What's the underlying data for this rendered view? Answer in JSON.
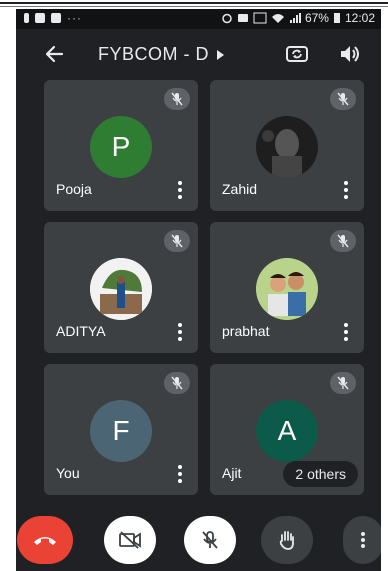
{
  "status_bar": {
    "left_icons": [
      "notification-icon",
      "image-icon",
      "gallery-icon"
    ],
    "overflow_dots": "···",
    "battery_percent": "67%",
    "time": "12:02"
  },
  "app_bar": {
    "meeting_title": "FYBCOM - D"
  },
  "participants": [
    {
      "name": "Pooja",
      "initial": "P",
      "avatar_color": "#2e7d32",
      "muted": true
    },
    {
      "name": "Zahid",
      "initial": "",
      "avatar_color": "#3a3a3a",
      "muted": true
    },
    {
      "name": "ADITYA",
      "initial": "",
      "avatar_color": "#6a8f5a",
      "muted": true
    },
    {
      "name": "prabhat",
      "initial": "",
      "avatar_color": "#9db870",
      "muted": true
    },
    {
      "name": "You",
      "initial": "F",
      "avatar_color": "#4c6575",
      "muted": true
    },
    {
      "name": "Ajit",
      "initial": "A",
      "avatar_color": "#0b5a4a",
      "muted": true
    }
  ],
  "others_chip": "2 others",
  "colors": {
    "background": "#202124",
    "tile": "#3c4043",
    "hangup": "#ea4335"
  }
}
